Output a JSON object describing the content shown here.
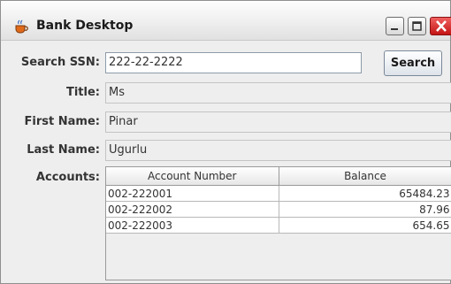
{
  "window": {
    "title": "Bank Desktop",
    "accent_close": "#d32020"
  },
  "form": {
    "search_ssn_label": "Search SSN:",
    "search_ssn_value": "222-22-2222",
    "search_button_label": "Search",
    "title_label": "Title:",
    "title_value": "Ms",
    "first_name_label": "First Name:",
    "first_name_value": "Pinar",
    "last_name_label": "Last Name:",
    "last_name_value": "Ugurlu",
    "accounts_label": "Accounts:"
  },
  "accounts_table": {
    "columns": [
      "Account Number",
      "Balance"
    ],
    "rows": [
      {
        "account_number": "002-222001",
        "balance": "65484.23"
      },
      {
        "account_number": "002-222002",
        "balance": "87.96"
      },
      {
        "account_number": "002-222003",
        "balance": "654.65"
      }
    ]
  }
}
